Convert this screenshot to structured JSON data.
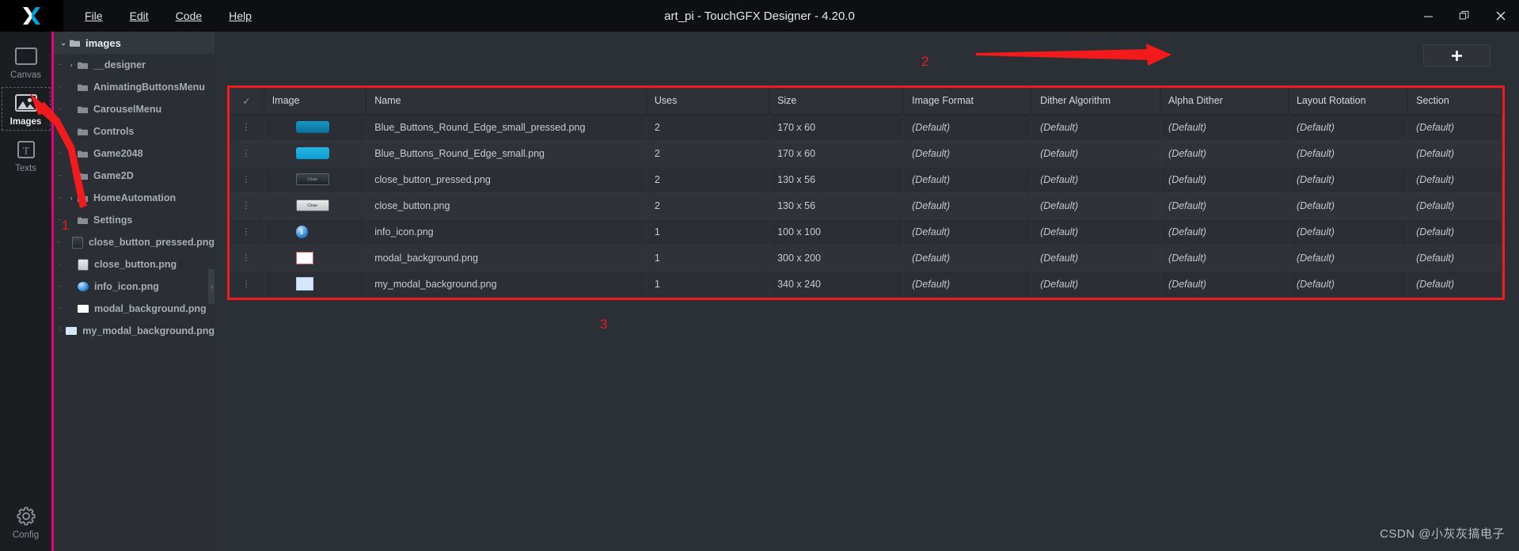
{
  "window": {
    "title": "art_pi - TouchGFX Designer - 4.20.0",
    "logo_name": "touchgfx-logo",
    "controls": {
      "minimize": "—",
      "maximize": "❐",
      "close": "✕"
    }
  },
  "menubar": {
    "items": [
      {
        "label": "File",
        "mnemonic": "F"
      },
      {
        "label": "Edit",
        "mnemonic": "E"
      },
      {
        "label": "Code",
        "mnemonic": "C"
      },
      {
        "label": "Help",
        "mnemonic": "H"
      }
    ]
  },
  "rail": {
    "items": [
      {
        "label": "Canvas",
        "icon": "canvas-icon",
        "active": false
      },
      {
        "label": "Images",
        "icon": "images-icon",
        "active": true
      },
      {
        "label": "Texts",
        "icon": "texts-icon",
        "active": false
      }
    ],
    "bottom": {
      "label": "Config",
      "icon": "gear-icon"
    }
  },
  "tree": {
    "root": {
      "label": "images",
      "expanded": true,
      "twisty": "⌄",
      "icon": "folder-icon"
    },
    "items": [
      {
        "label": "__designer",
        "type": "folder",
        "twisty": "›",
        "expandable": true
      },
      {
        "label": "AnimatingButtonsMenu",
        "type": "folder",
        "twisty": "",
        "expandable": false
      },
      {
        "label": "CarouselMenu",
        "type": "folder",
        "twisty": "",
        "expandable": false
      },
      {
        "label": "Controls",
        "type": "folder",
        "twisty": "",
        "expandable": false
      },
      {
        "label": "Game2048",
        "type": "folder",
        "twisty": "",
        "expandable": false
      },
      {
        "label": "Game2D",
        "type": "folder",
        "twisty": "",
        "expandable": false
      },
      {
        "label": "HomeAutomation",
        "type": "folder",
        "twisty": "›",
        "expandable": true
      },
      {
        "label": "Settings",
        "type": "folder",
        "twisty": "",
        "expandable": false
      },
      {
        "label": "close_button_pressed.png",
        "type": "file",
        "thumb": "close-pressed"
      },
      {
        "label": "close_button.png",
        "type": "file",
        "thumb": "close"
      },
      {
        "label": "info_icon.png",
        "type": "file",
        "thumb": "info"
      },
      {
        "label": "modal_background.png",
        "type": "file",
        "thumb": "modal"
      },
      {
        "label": "my_modal_background.png",
        "type": "file",
        "thumb": "mymodal"
      }
    ],
    "splitter_glyph": "‹"
  },
  "toolbar": {
    "add_label": "＋"
  },
  "table": {
    "columns": [
      "✓",
      "Image",
      "Name",
      "Uses",
      "Size",
      "Image Format",
      "Dither Algorithm",
      "Alpha Dither",
      "Layout Rotation",
      "Section"
    ],
    "handle_glyph": "⋮",
    "rows": [
      {
        "thumb": "blue-dark",
        "name": "Blue_Buttons_Round_Edge_small_pressed.png",
        "uses": "2",
        "size": "170 x 60",
        "image_format": "(Default)",
        "dither_algorithm": "(Default)",
        "alpha_dither": "(Default)",
        "layout_rotation": "(Default)",
        "section": "(Default)"
      },
      {
        "thumb": "blue-light",
        "name": "Blue_Buttons_Round_Edge_small.png",
        "uses": "2",
        "size": "170 x 60",
        "image_format": "(Default)",
        "dither_algorithm": "(Default)",
        "alpha_dither": "(Default)",
        "layout_rotation": "(Default)",
        "section": "(Default)"
      },
      {
        "thumb": "close-pressed",
        "name": "close_button_pressed.png",
        "uses": "2",
        "size": "130 x 56",
        "image_format": "(Default)",
        "dither_algorithm": "(Default)",
        "alpha_dither": "(Default)",
        "layout_rotation": "(Default)",
        "section": "(Default)"
      },
      {
        "thumb": "close",
        "name": "close_button.png",
        "uses": "2",
        "size": "130 x 56",
        "image_format": "(Default)",
        "dither_algorithm": "(Default)",
        "alpha_dither": "(Default)",
        "layout_rotation": "(Default)",
        "section": "(Default)"
      },
      {
        "thumb": "info",
        "name": "info_icon.png",
        "uses": "1",
        "size": "100 x 100",
        "image_format": "(Default)",
        "dither_algorithm": "(Default)",
        "alpha_dither": "(Default)",
        "layout_rotation": "(Default)",
        "section": "(Default)"
      },
      {
        "thumb": "modal",
        "name": "modal_background.png",
        "uses": "1",
        "size": "300 x 200",
        "image_format": "(Default)",
        "dither_algorithm": "(Default)",
        "alpha_dither": "(Default)",
        "layout_rotation": "(Default)",
        "section": "(Default)"
      },
      {
        "thumb": "mymodal",
        "name": "my_modal_background.png",
        "uses": "1",
        "size": "340 x 240",
        "image_format": "(Default)",
        "dither_algorithm": "(Default)",
        "alpha_dither": "(Default)",
        "layout_rotation": "(Default)",
        "section": "(Default)"
      }
    ]
  },
  "annotations": {
    "color": "#f21a1a",
    "marker_1": "1",
    "marker_2": "2",
    "marker_3": "3"
  },
  "watermark": {
    "text": "CSDN @小灰灰搞电子"
  },
  "colors": {
    "accent_pink": "#e8007d",
    "annotation_red": "#f21a1a",
    "titlebar_bg": "#0d0f12",
    "panel_bg": "#2b2e34",
    "main_bg": "#2b2f36"
  }
}
